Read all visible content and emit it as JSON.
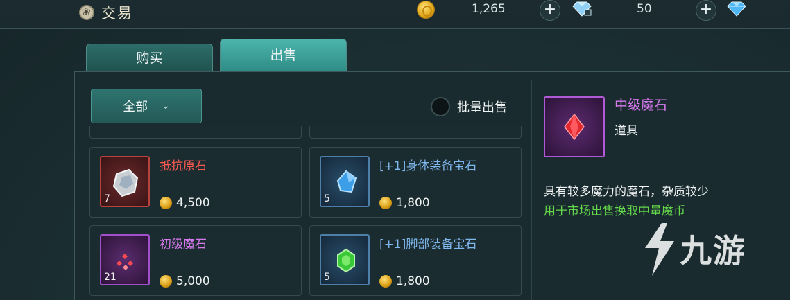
{
  "header": {
    "title": "交易",
    "title_icon": "settings-flower-icon",
    "currencies": [
      {
        "icon": "gold-coin-icon",
        "value": "1,265"
      },
      {
        "icon": "bound-diamond-icon",
        "value": "50"
      },
      {
        "icon": "diamond-icon",
        "value": ""
      }
    ],
    "plus_label": "+"
  },
  "tabs": [
    {
      "label": "购买",
      "active": false
    },
    {
      "label": "出售",
      "active": true
    }
  ],
  "filter": {
    "selected": "全部",
    "icon": "chevron-down-icon"
  },
  "batch_sell": {
    "label": "批量出售",
    "checked": false
  },
  "items": [
    {
      "name": "抵抗原石",
      "qty": "7",
      "price": "4,500",
      "name_color": "#ff5a52",
      "rarity": "red"
    },
    {
      "name": "[+1]身体装备宝石",
      "qty": "5",
      "price": "1,800",
      "name_color": "#7fb8ee",
      "rarity": "blue"
    },
    {
      "name": "初级魔石",
      "qty": "21",
      "price": "5,000",
      "name_color": "#d879f0",
      "rarity": "purple"
    },
    {
      "name": "[+1]脚部装备宝石",
      "qty": "5",
      "price": "1,800",
      "name_color": "#7fb8ee",
      "rarity": "blue"
    }
  ],
  "detail": {
    "name": "中级魔石",
    "type": "道具",
    "description": "具有较多魔力的魔石，杂质较少",
    "usage": "用于市场出售换取中量魔币"
  },
  "watermark": {
    "text": "九游"
  },
  "colors": {
    "accent_teal": "#2e8c86",
    "purple": "#d879f0",
    "green": "#64d84a",
    "red": "#ff5a52",
    "blue": "#7fb8ee"
  }
}
